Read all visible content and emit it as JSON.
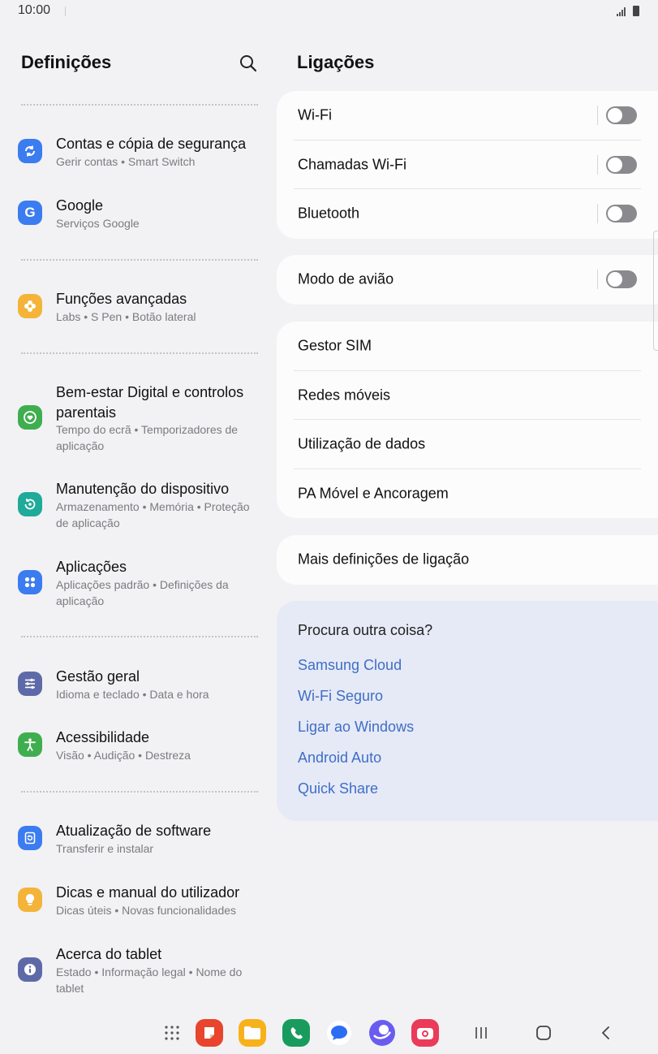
{
  "status_bar": {
    "time": "10:00"
  },
  "left_panel": {
    "title": "Definições",
    "items": [
      {
        "title": "Contas e cópia de segurança",
        "subtitle": "Gerir contas  •  Smart Switch",
        "icon": "sync-icon",
        "color": "#3b7cf0"
      },
      {
        "title": "Google",
        "subtitle": "Serviços Google",
        "icon": "google-icon",
        "color": "#3b7cf0"
      },
      {
        "title": "Funções avançadas",
        "subtitle": "Labs  •  S Pen  •  Botão lateral",
        "icon": "flower-icon",
        "color": "#f4b43a"
      },
      {
        "title": "Bem-estar Digital e controlos parentais",
        "subtitle": "Tempo do ecrã  •  Temporizadores de aplicação",
        "icon": "heart-circle-icon",
        "color": "#3fae4f"
      },
      {
        "title": "Manutenção do dispositivo",
        "subtitle": "Armazenamento  •  Memória  •  Proteção de aplicação",
        "icon": "refresh-circle-icon",
        "color": "#1faa9a"
      },
      {
        "title": "Aplicações",
        "subtitle": "Aplicações padrão  •  Definições da aplicação",
        "icon": "apps-grid-icon",
        "color": "#3b7cf0"
      },
      {
        "title": "Gestão geral",
        "subtitle": "Idioma e teclado  •  Data e hora",
        "icon": "sliders-icon",
        "color": "#5e6aa8"
      },
      {
        "title": "Acessibilidade",
        "subtitle": "Visão  •  Audição  •  Destreza",
        "icon": "accessibility-icon",
        "color": "#3fae4f"
      },
      {
        "title": "Atualização de software",
        "subtitle": "Transferir e instalar",
        "icon": "software-update-icon",
        "color": "#3b7cf0"
      },
      {
        "title": "Dicas e manual do utilizador",
        "subtitle": "Dicas úteis  •  Novas funcionalidades",
        "icon": "lightbulb-icon",
        "color": "#f4b43a"
      },
      {
        "title": "Acerca do tablet",
        "subtitle": "Estado  •  Informação legal  •  Nome do tablet",
        "icon": "info-icon",
        "color": "#5e6aa8"
      }
    ]
  },
  "right_panel": {
    "title": "Ligações",
    "group1": [
      {
        "label": "Wi-Fi",
        "toggle": false
      },
      {
        "label": "Chamadas Wi-Fi",
        "toggle": false
      },
      {
        "label": "Bluetooth",
        "toggle": false
      }
    ],
    "group2": [
      {
        "label": "Modo de avião",
        "toggle": false
      }
    ],
    "group3": [
      {
        "label": "Gestor SIM"
      },
      {
        "label": "Redes móveis"
      },
      {
        "label": "Utilização de dados"
      },
      {
        "label": "PA Móvel e Ancoragem"
      }
    ],
    "group4": [
      {
        "label": "Mais definições de ligação"
      }
    ],
    "suggestions": {
      "question": "Procura outra coisa?",
      "links": [
        "Samsung Cloud",
        "Wi-Fi Seguro",
        "Ligar ao Windows",
        "Android Auto",
        "Quick Share"
      ]
    }
  },
  "dock": {
    "apps": [
      {
        "name": "app-drawer-icon",
        "color": "#555555"
      },
      {
        "name": "notes-app-icon",
        "color": "#e8442e"
      },
      {
        "name": "files-app-icon",
        "color": "#f7b21b"
      },
      {
        "name": "phone-app-icon",
        "color": "#1a9b5e"
      },
      {
        "name": "messages-app-icon",
        "color": "#2c6ef2"
      },
      {
        "name": "internet-app-icon",
        "color": "#6b5cf0"
      },
      {
        "name": "camera-app-icon",
        "color": "#ea3b5a"
      }
    ],
    "nav": [
      "recents-icon",
      "home-icon",
      "back-icon"
    ]
  }
}
